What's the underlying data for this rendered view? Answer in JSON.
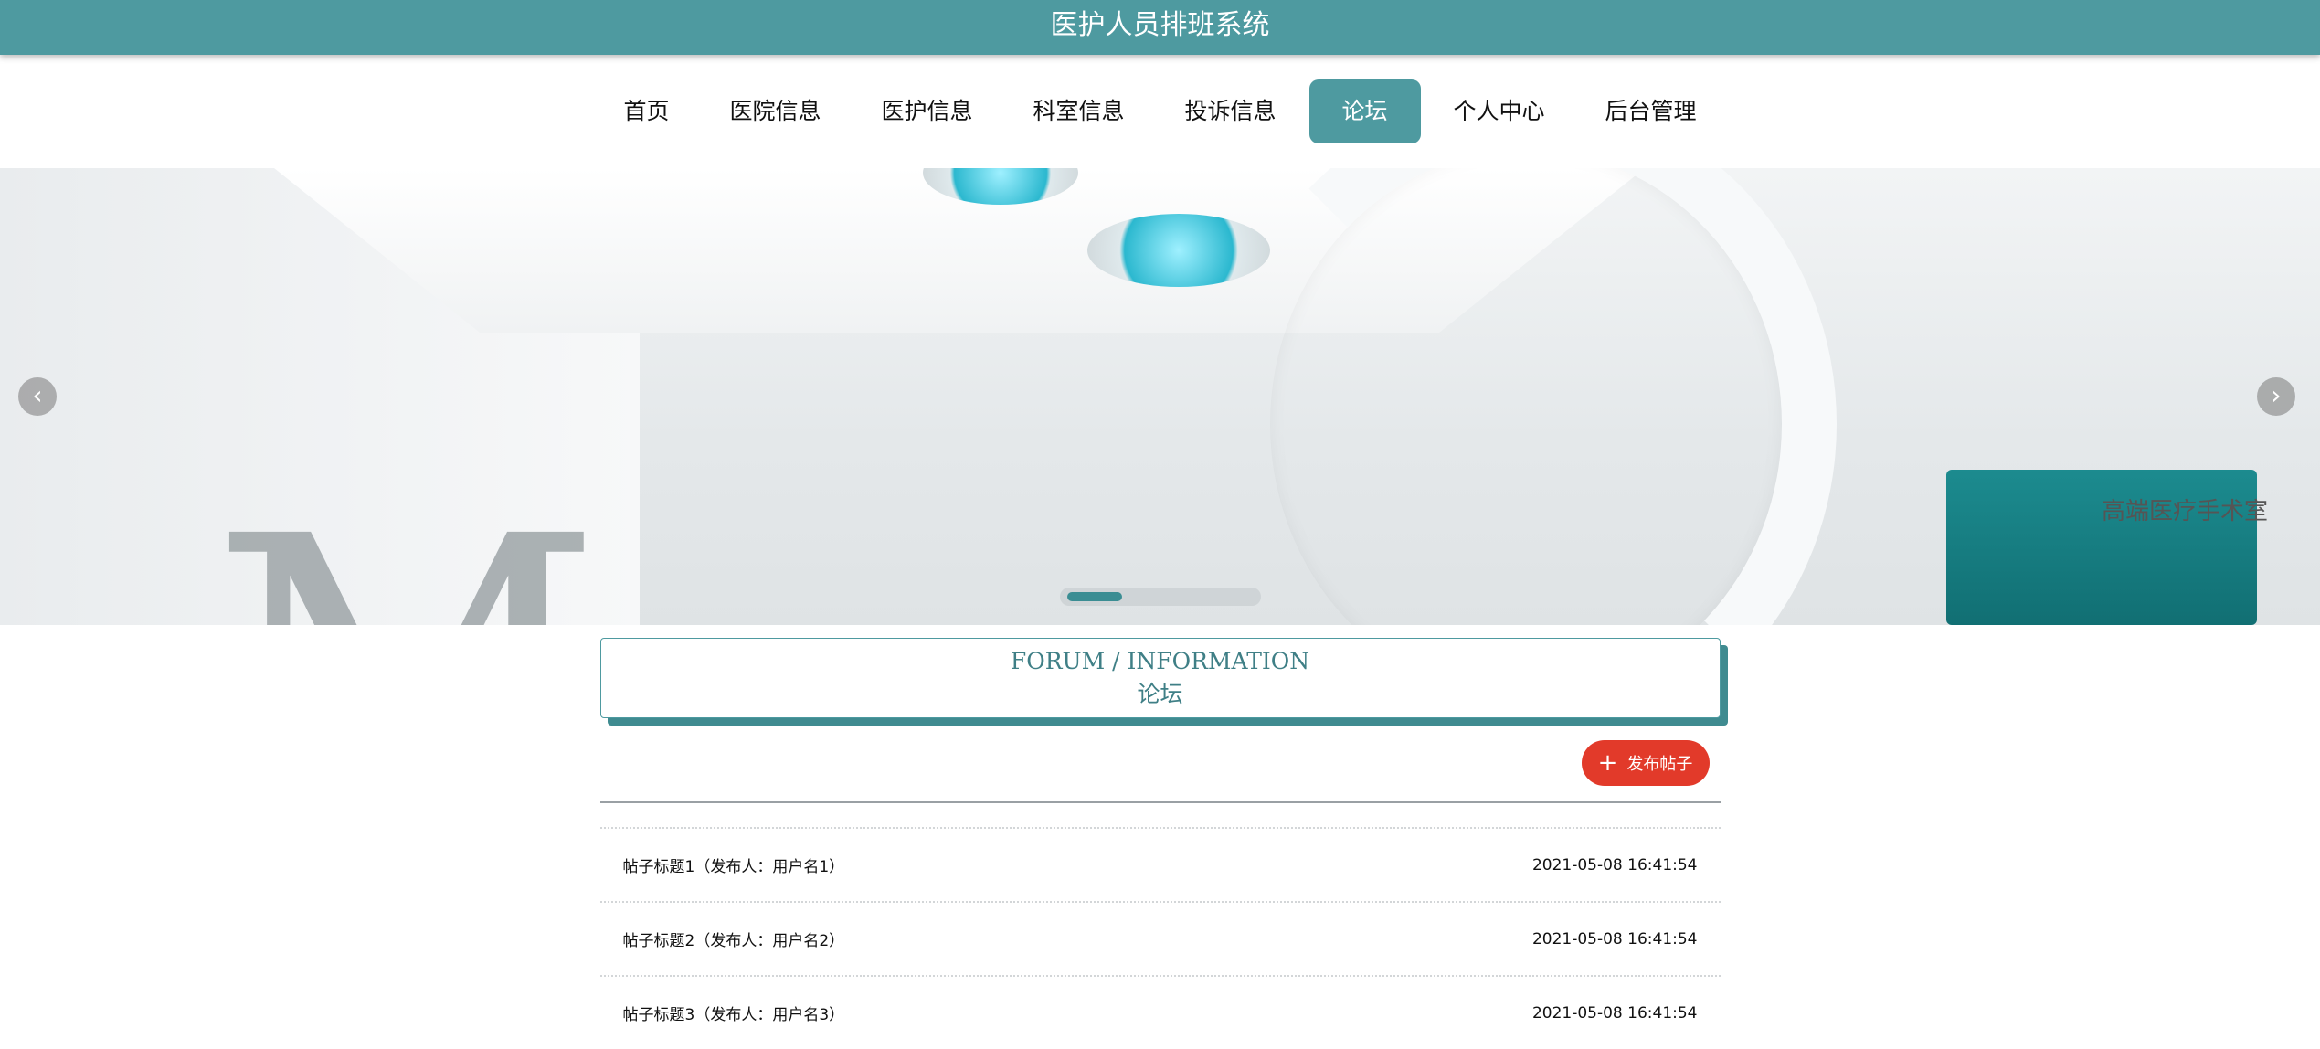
{
  "header": {
    "title": "医护人员排班系统"
  },
  "nav": {
    "items": [
      {
        "label": "首页"
      },
      {
        "label": "医院信息"
      },
      {
        "label": "医护信息"
      },
      {
        "label": "科室信息"
      },
      {
        "label": "投诉信息"
      },
      {
        "label": "论坛",
        "active": true
      },
      {
        "label": "个人中心"
      },
      {
        "label": "后台管理"
      }
    ]
  },
  "banner": {
    "prev_icon": "chevron-left-icon",
    "next_icon": "chevron-right-icon",
    "prev_glyph": "‹",
    "next_glyph": "›",
    "letter": "M",
    "sign": "高端医疗手术室"
  },
  "section": {
    "title_en": "FORUM / INFORMATION",
    "title_cn": "论坛"
  },
  "actions": {
    "post_label": "发布帖子",
    "post_icon": "plus-icon",
    "post_glyph": "+"
  },
  "posts": [
    {
      "title": "帖子标题1（发布人：用户名1）",
      "time": "2021-05-08 16:41:54"
    },
    {
      "title": "帖子标题2（发布人：用户名2）",
      "time": "2021-05-08 16:41:54"
    },
    {
      "title": "帖子标题3（发布人：用户名3）",
      "time": "2021-05-08 16:41:54"
    }
  ],
  "colors": {
    "primary": "#4e9aa0",
    "accent": "#e23a2a"
  }
}
